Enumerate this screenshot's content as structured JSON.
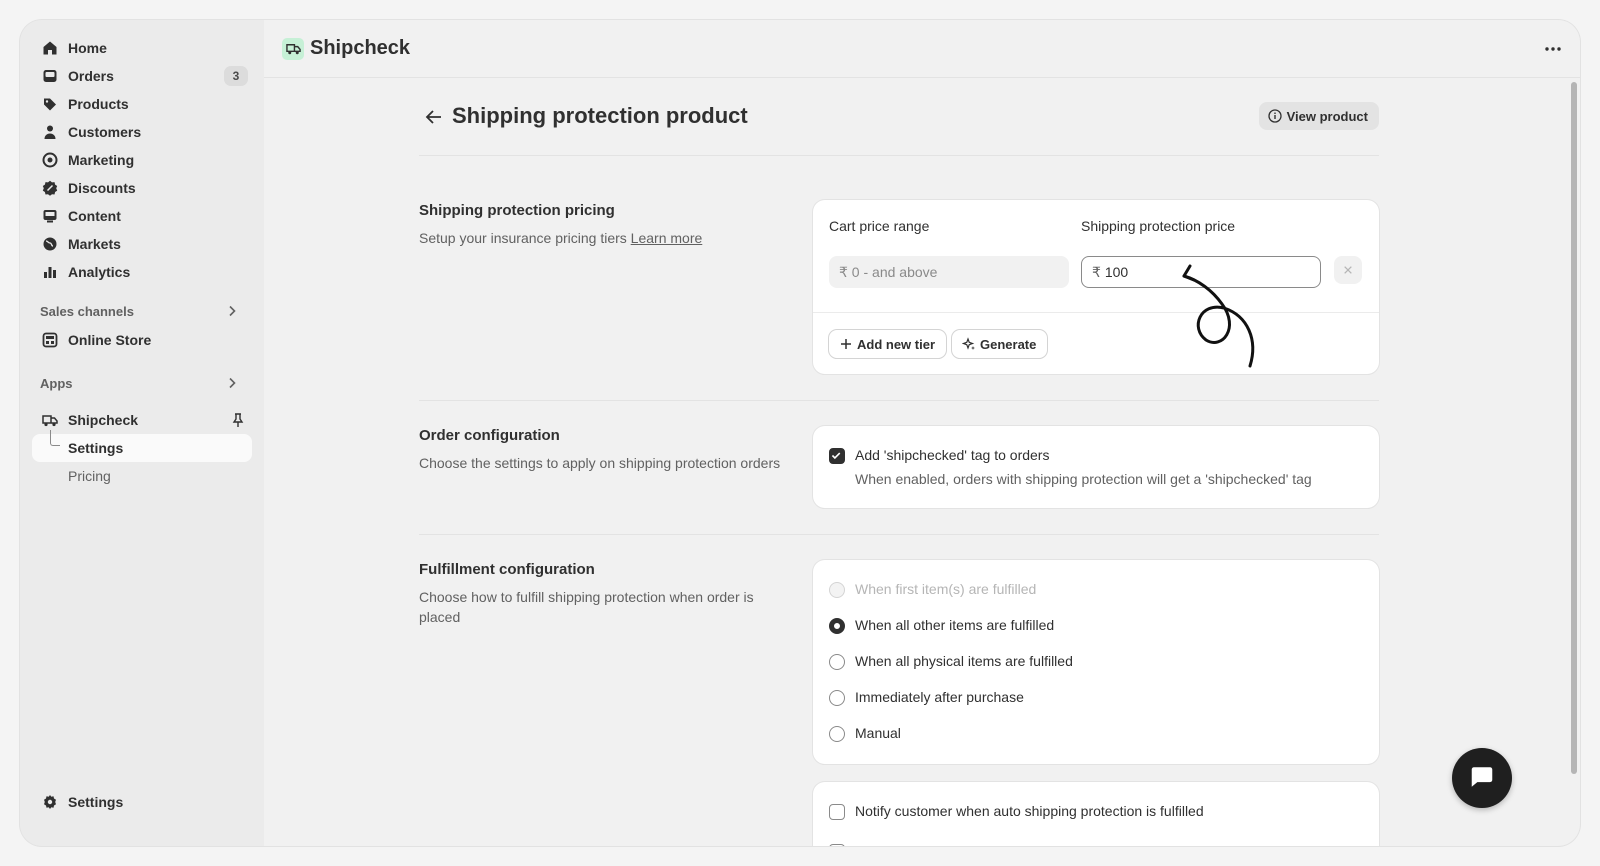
{
  "sidebar": {
    "items": [
      {
        "label": "Home",
        "icon": "home-icon"
      },
      {
        "label": "Orders",
        "icon": "orders-icon",
        "badge": "3"
      },
      {
        "label": "Products",
        "icon": "tag-icon"
      },
      {
        "label": "Customers",
        "icon": "person-icon"
      },
      {
        "label": "Marketing",
        "icon": "target-icon"
      },
      {
        "label": "Discounts",
        "icon": "discount-icon"
      },
      {
        "label": "Content",
        "icon": "content-icon"
      },
      {
        "label": "Markets",
        "icon": "globe-icon"
      },
      {
        "label": "Analytics",
        "icon": "bar-chart-icon"
      }
    ],
    "sales_channels": {
      "heading": "Sales channels",
      "items": [
        {
          "label": "Online Store"
        }
      ]
    },
    "apps": {
      "heading": "Apps",
      "app": {
        "label": "Shipcheck"
      },
      "sub_items": [
        {
          "label": "Settings"
        },
        {
          "label": "Pricing"
        }
      ]
    },
    "settings_label": "Settings"
  },
  "topbar": {
    "app_title": "Shipcheck"
  },
  "page": {
    "title": "Shipping protection product",
    "view_product_label": "View product"
  },
  "pricing": {
    "title": "Shipping protection pricing",
    "desc": "Setup your insurance pricing tiers",
    "learn_more": "Learn more",
    "cart_range_label": "Cart price range",
    "protection_price_label": "Shipping protection price",
    "range_prefix": "₹ 0 -",
    "range_value": "and above",
    "price_prefix": "₹",
    "price_value": "100",
    "add_tier_label": "Add new tier",
    "generate_label": "Generate"
  },
  "order_config": {
    "title": "Order configuration",
    "desc": "Choose the settings to apply on shipping protection orders",
    "checkbox_label": "Add 'shipchecked' tag to orders",
    "checkbox_help": "When enabled, orders with shipping protection will get a 'shipchecked' tag",
    "checked": true
  },
  "fulfillment": {
    "title": "Fulfillment configuration",
    "desc": "Choose how to fulfill shipping protection when order is placed",
    "options": [
      {
        "label": "When first item(s) are fulfilled",
        "state": "disabled"
      },
      {
        "label": "When all other items are fulfilled",
        "state": "selected"
      },
      {
        "label": "When all physical items are fulfilled",
        "state": "unselected"
      },
      {
        "label": "Immediately after purchase",
        "state": "unselected"
      },
      {
        "label": "Manual",
        "state": "unselected"
      }
    ],
    "notify_label": "Notify customer when auto shipping protection is fulfilled"
  },
  "colors": {
    "accent": "#303030",
    "logo_bg": "#c6f0d6",
    "fab": "#1f1f1f"
  }
}
